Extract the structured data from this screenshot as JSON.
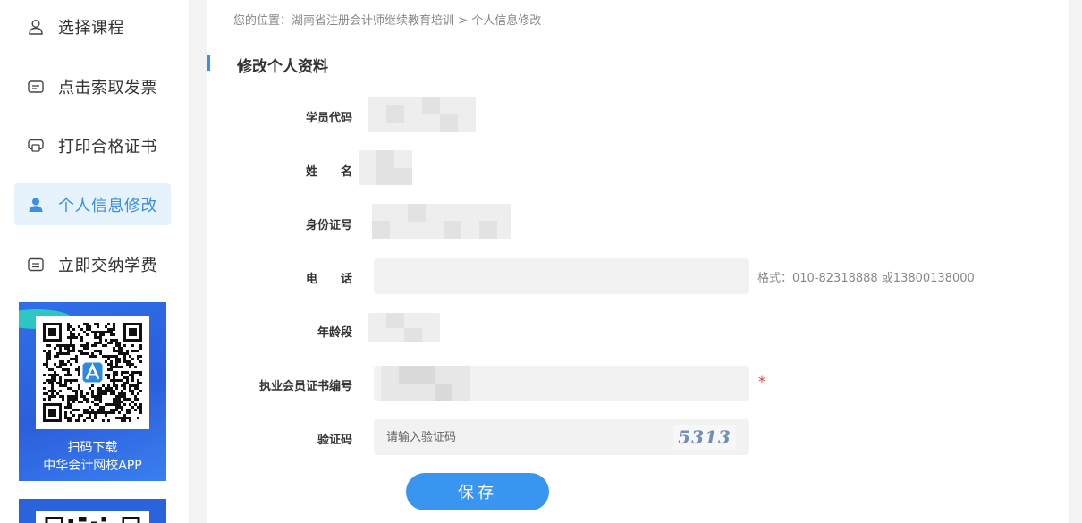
{
  "sidebar": {
    "items": [
      {
        "label": "选择课程",
        "icon": "user-icon",
        "active": false
      },
      {
        "label": "点击索取发票",
        "icon": "invoice-icon",
        "active": false
      },
      {
        "label": "打印合格证书",
        "icon": "certificate-icon",
        "active": false
      },
      {
        "label": "个人信息修改",
        "icon": "user-icon",
        "active": true
      },
      {
        "label": "立即交纳学费",
        "icon": "payment-icon",
        "active": false
      }
    ],
    "promo": {
      "line1": "扫码下载",
      "line2": "中华会计网校APP"
    }
  },
  "breadcrumb": {
    "prefix": "您的位置：",
    "path": "湖南省注册会计师继续教育培训",
    "separator": " > ",
    "current": "个人信息修改"
  },
  "form": {
    "title": "修改个人资料",
    "student_code_label": "学员代码",
    "name_label": "姓　　名",
    "id_number_label": "身份证号",
    "phone_label": "电　　话",
    "phone_hint": "格式：010-82318888 或13800138000",
    "age_group_label": "年龄段",
    "cert_number_label": "执业会员证书编号",
    "required_mark": "*",
    "captcha_label": "验证码",
    "captcha_placeholder": "请输入验证码",
    "captcha_code": "5313",
    "save_label": "保存"
  },
  "colors": {
    "accent": "#3b8fe5",
    "button": "#3a95f0",
    "active_bg": "#e6f2fc",
    "required": "#e04040"
  }
}
